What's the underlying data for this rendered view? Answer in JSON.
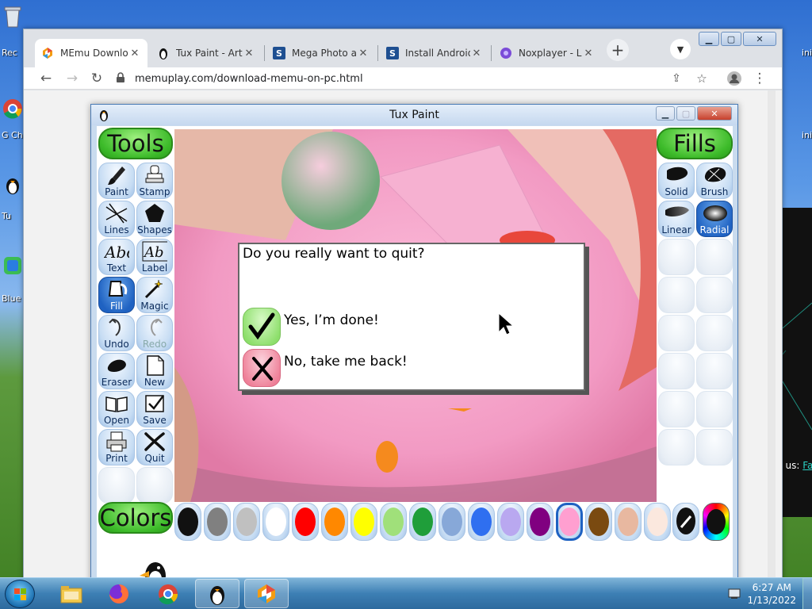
{
  "desktop": {
    "icons": [
      {
        "name": "recycle-bin",
        "label": "Rec"
      },
      {
        "name": "google-chrome",
        "label": "G Ch"
      },
      {
        "name": "tux-paint",
        "label": "Tu"
      },
      {
        "name": "bluestacks",
        "label": "Blue"
      }
    ],
    "right_labels": [
      "ini",
      "ini"
    ],
    "contact_label": "Contact us:",
    "contact_link": "Fa"
  },
  "browser": {
    "tabs": [
      {
        "title": "MEmu Downlo",
        "favicon": "memu-icon",
        "active": true
      },
      {
        "title": "Tux Paint - Art",
        "favicon": "tux-icon",
        "active": false
      },
      {
        "title": "Mega Photo ap",
        "favicon": "s-icon",
        "active": false
      },
      {
        "title": "Install Android",
        "favicon": "s-icon",
        "active": false
      },
      {
        "title": "Noxplayer - L'",
        "favicon": "nox-icon",
        "active": false
      }
    ],
    "url": "memuplay.com/download-memu-on-pc.html"
  },
  "tuxpaint": {
    "title": "Tux Paint",
    "tools_header": "Tools",
    "fills_header": "Fills",
    "colors_header": "Colors",
    "tools": [
      {
        "label": "Paint",
        "icon": "paintbrush-icon"
      },
      {
        "label": "Stamp",
        "icon": "stamp-icon"
      },
      {
        "label": "Lines",
        "icon": "lines-icon"
      },
      {
        "label": "Shapes",
        "icon": "pentagon-icon"
      },
      {
        "label": "Text",
        "icon": "text-abc-icon"
      },
      {
        "label": "Label",
        "icon": "label-abc-icon"
      },
      {
        "label": "Fill",
        "icon": "paint-bucket-icon",
        "selected": true
      },
      {
        "label": "Magic",
        "icon": "magic-wand-icon"
      },
      {
        "label": "Undo",
        "icon": "undo-icon"
      },
      {
        "label": "Redo",
        "icon": "redo-icon",
        "disabled": true
      },
      {
        "label": "Eraser",
        "icon": "eraser-icon"
      },
      {
        "label": "New",
        "icon": "new-page-icon"
      },
      {
        "label": "Open",
        "icon": "open-book-icon"
      },
      {
        "label": "Save",
        "icon": "save-icon"
      },
      {
        "label": "Print",
        "icon": "printer-icon"
      },
      {
        "label": "Quit",
        "icon": "quit-icon"
      }
    ],
    "fills": [
      {
        "label": "Solid",
        "icon": "solid-fill-icon"
      },
      {
        "label": "Brush",
        "icon": "brush-fill-icon"
      },
      {
        "label": "Linear",
        "icon": "linear-fill-icon"
      },
      {
        "label": "Radial",
        "icon": "radial-fill-icon",
        "selected": true
      }
    ],
    "palette": [
      "#111111",
      "#808080",
      "#c0c0c0",
      "#ffffff",
      "#ff0000",
      "#ff8800",
      "#ffff00",
      "#a0e07a",
      "#1f9e3a",
      "#87a8d8",
      "#2f6ff0",
      "#b9a8f0",
      "#800080",
      "#ff9fd0",
      "#7a4a10",
      "#e8b8a0",
      "#fbe8de"
    ],
    "selected_color_index": 13,
    "dialog": {
      "question": "Do you really want to quit?",
      "yes_label": "Yes, I’m done!",
      "no_label": "No, take me back!"
    }
  },
  "taskbar": {
    "time": "6:27 AM",
    "date": "1/13/2022",
    "apps": [
      "file-explorer",
      "firefox",
      "chrome",
      "tux-paint",
      "memu"
    ]
  }
}
